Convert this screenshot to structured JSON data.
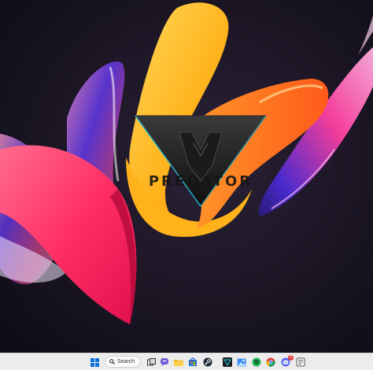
{
  "wallpaper": {
    "logo_text": "PREDATOR",
    "colors": {
      "background": "#14101c",
      "pink": "#ff3b6e",
      "yellow": "#ffc21a",
      "orange": "#ff8a1a",
      "violet": "#5b2cc9",
      "cyan_accent": "#28d0e8"
    }
  },
  "taskbar": {
    "search": {
      "label": "Search",
      "icon": "search-icon"
    },
    "icons": [
      {
        "name": "start-icon"
      },
      {
        "name": "task-view-icon"
      },
      {
        "name": "teams-chat-icon"
      },
      {
        "name": "file-explorer-icon"
      },
      {
        "name": "microsoft-store-icon"
      },
      {
        "name": "steam-icon"
      },
      {
        "name": "predatorsense-icon"
      },
      {
        "name": "photos-icon"
      },
      {
        "name": "spotify-icon"
      },
      {
        "name": "chrome-icon"
      },
      {
        "name": "discord-icon",
        "badge": "3"
      },
      {
        "name": "notes-app-icon"
      }
    ]
  }
}
